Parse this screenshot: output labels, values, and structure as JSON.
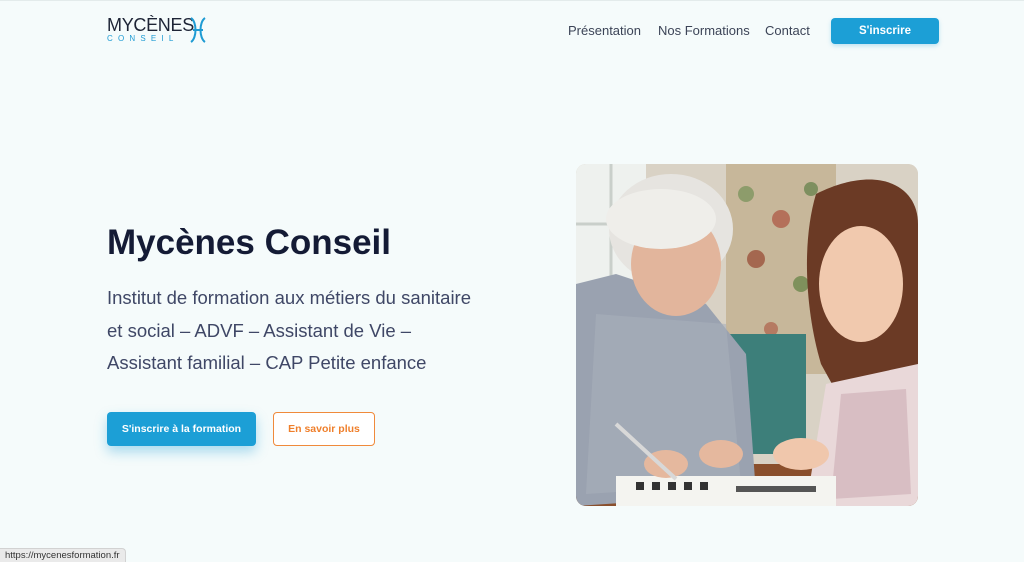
{
  "header": {
    "logo_text": "MYCÈNES",
    "logo_subtext": "CONSEIL",
    "nav": [
      "Présentation",
      "Nos Formations",
      "Contact"
    ],
    "cta_label": "S'inscrire"
  },
  "hero": {
    "title": "Mycènes Conseil",
    "description": "Institut de formation aux métiers du sanitaire et social – ADVF – Assistant de Vie – Assistant familial – CAP Petite enfance",
    "primary_button": "S'inscrire à la formation",
    "secondary_button": "En savoir plus",
    "image_icon": "photo-elderly-woman-with-young-woman"
  },
  "status_bar": {
    "url": "https://mycenesformation.fr"
  },
  "colors": {
    "accent": "#1c9fd6",
    "secondary": "#ef7f2b",
    "background": "#f5fbfb",
    "heading": "#141b35"
  }
}
